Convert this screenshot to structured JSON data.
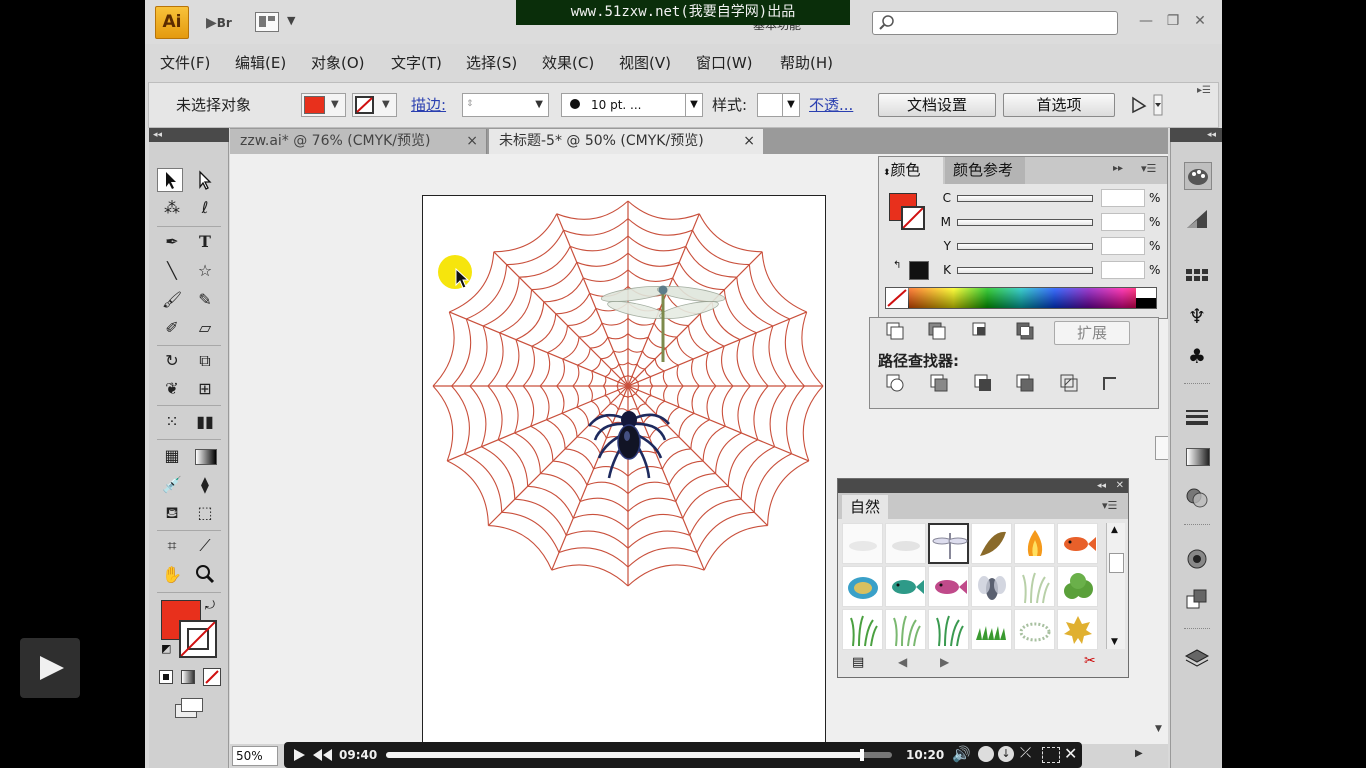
{
  "app": {
    "logo": "Ai",
    "bridge_label": "Br",
    "banner": "www.51zxw.net(我要自学网)出品",
    "workspace_label": "基本功能"
  },
  "menu": [
    "文件(F)",
    "编辑(E)",
    "对象(O)",
    "文字(T)",
    "选择(S)",
    "效果(C)",
    "视图(V)",
    "窗口(W)",
    "帮助(H)"
  ],
  "control_bar": {
    "selection_status": "未选择对象",
    "stroke_label": "描边:",
    "brush_size": "10 pt. ...",
    "style_label": "样式:",
    "opacity_link": "不透...",
    "doc_setup_button": "文档设置",
    "prefs_button": "首选项"
  },
  "tabs": [
    {
      "label": "zzw.ai* @ 76% (CMYK/预览)",
      "close": "×"
    },
    {
      "label": "未标题-5* @ 50% (CMYK/预览)",
      "close": "×"
    }
  ],
  "color_panel": {
    "tabs": [
      "颜色",
      "颜色参考"
    ],
    "sliders": [
      {
        "label": "C",
        "value": ""
      },
      {
        "label": "M",
        "value": ""
      },
      {
        "label": "Y",
        "value": ""
      },
      {
        "label": "K",
        "value": ""
      }
    ],
    "percent": "%"
  },
  "pathfinder_panel": {
    "expand_button": "扩展",
    "title": "路径查找器:"
  },
  "symbols_panel": {
    "tab": "自然"
  },
  "status": {
    "zoom": "50%"
  },
  "player": {
    "current_time": "09:40",
    "total_time": "10:20",
    "progress": 0.94
  },
  "colors": {
    "fill": "#e8301c",
    "web": "#c9503c",
    "banner_bg": "#0a2e0a",
    "spider": "#1e2a5e"
  }
}
